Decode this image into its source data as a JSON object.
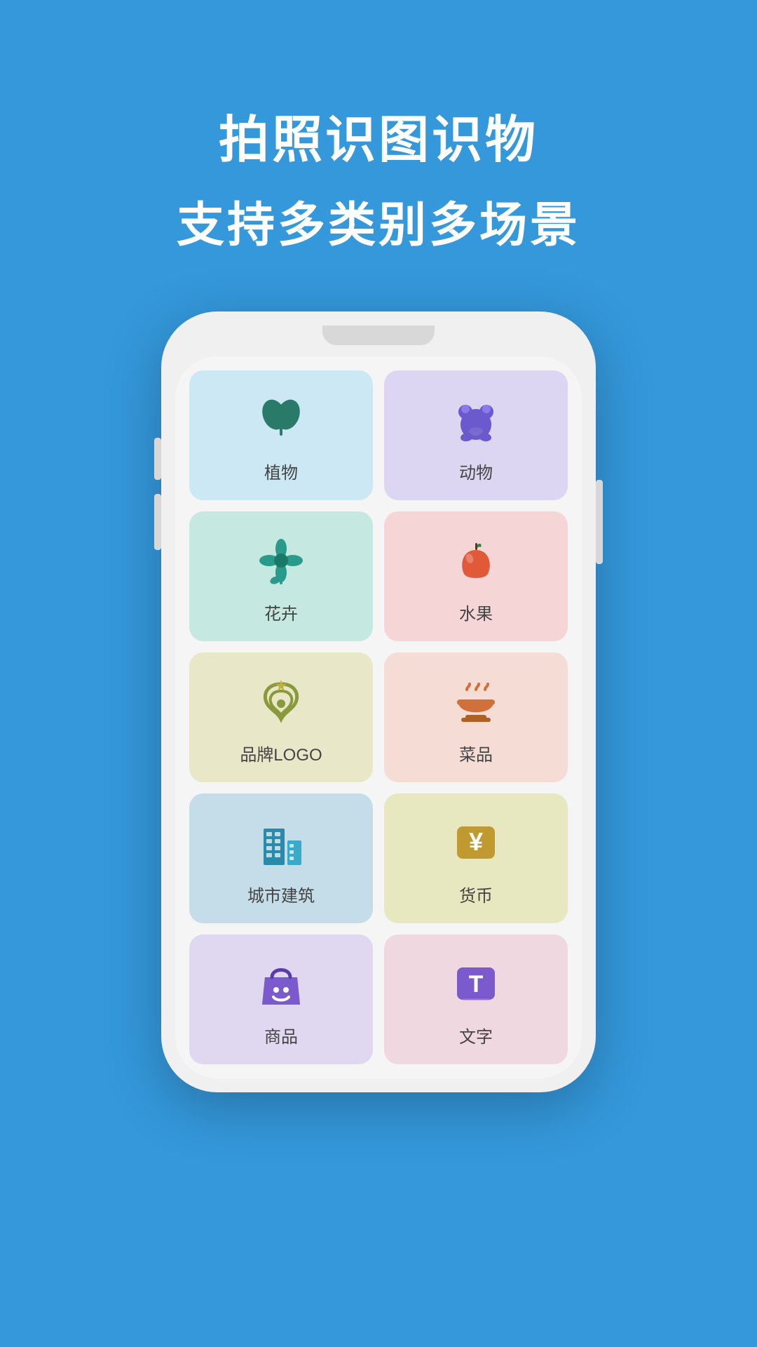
{
  "background_color": "#3498db",
  "header": {
    "line1": "拍照识图识物",
    "line2": "支持多类别多场景"
  },
  "grid_items": [
    {
      "id": "plant",
      "label": "植物",
      "bg_class": "bg-light-blue",
      "icon_class": "icon-plant",
      "icon_type": "plant"
    },
    {
      "id": "animal",
      "label": "动物",
      "bg_class": "bg-light-purple",
      "icon_class": "icon-animal",
      "icon_type": "animal"
    },
    {
      "id": "flower",
      "label": "花卉",
      "bg_class": "bg-light-teal",
      "icon_class": "icon-flower",
      "icon_type": "flower"
    },
    {
      "id": "fruit",
      "label": "水果",
      "bg_class": "bg-light-pink",
      "icon_class": "icon-fruit",
      "icon_type": "fruit"
    },
    {
      "id": "logo",
      "label": "品牌LOGO",
      "bg_class": "bg-light-yellow-green",
      "icon_class": "icon-logo",
      "icon_type": "logo"
    },
    {
      "id": "food",
      "label": "菜品",
      "bg_class": "bg-light-peach",
      "icon_class": "icon-food",
      "icon_type": "food"
    },
    {
      "id": "building",
      "label": "城市建筑",
      "bg_class": "bg-light-cyan",
      "icon_class": "icon-building",
      "icon_type": "building"
    },
    {
      "id": "currency",
      "label": "货币",
      "bg_class": "bg-light-cream",
      "icon_class": "icon-currency",
      "icon_type": "currency"
    },
    {
      "id": "shopping",
      "label": "商品",
      "bg_class": "bg-light-lavender",
      "icon_class": "icon-shopping",
      "icon_type": "shopping"
    },
    {
      "id": "text",
      "label": "文字",
      "bg_class": "bg-light-rose",
      "icon_class": "icon-text",
      "icon_type": "text"
    }
  ]
}
